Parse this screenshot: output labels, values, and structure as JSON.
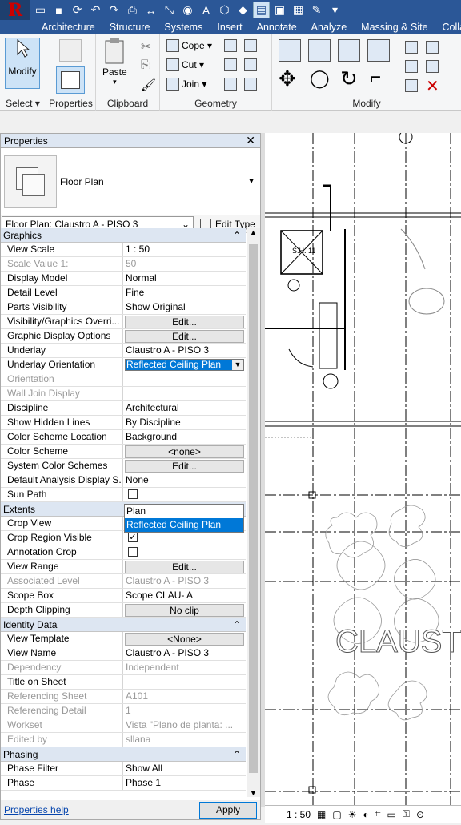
{
  "ribbon": {
    "tabs": [
      "Architecture",
      "Structure",
      "Systems",
      "Insert",
      "Annotate",
      "Analyze",
      "Massing & Site",
      "Colla"
    ],
    "panels": {
      "select": "Select",
      "properties": "Properties",
      "clipboard": "Clipboard",
      "geometry": "Geometry",
      "modify": "Modify"
    },
    "buttons": {
      "modify": "Modify",
      "paste": "Paste",
      "cope": "Cope",
      "cut": "Cut",
      "join": "Join"
    }
  },
  "properties": {
    "title": "Properties",
    "type_name": "Floor Plan",
    "instance": "Floor Plan: Claustro A - PISO 3",
    "edit_type": "Edit Type",
    "help": "Properties help",
    "apply": "Apply",
    "sections": {
      "graphics": "Graphics",
      "extents": "Extents",
      "identity": "Identity Data",
      "phasing": "Phasing"
    },
    "graphics": [
      [
        "View Scale",
        "1 : 50"
      ],
      [
        "Scale Value    1:",
        "50"
      ],
      [
        "Display Model",
        "Normal"
      ],
      [
        "Detail Level",
        "Fine"
      ],
      [
        "Parts Visibility",
        "Show Original"
      ],
      [
        "Visibility/Graphics Overri...",
        "Edit..."
      ],
      [
        "Graphic Display Options",
        "Edit..."
      ],
      [
        "Underlay",
        "Claustro A - PISO 3"
      ],
      [
        "Underlay Orientation",
        "Reflected Ceiling Plan"
      ],
      [
        "Orientation",
        ""
      ],
      [
        "Wall Join Display",
        ""
      ],
      [
        "Discipline",
        "Architectural"
      ],
      [
        "Show Hidden Lines",
        "By Discipline"
      ],
      [
        "Color Scheme Location",
        "Background"
      ],
      [
        "Color Scheme",
        "<none>"
      ],
      [
        "System Color Schemes",
        "Edit..."
      ],
      [
        "Default Analysis Display S...",
        "None"
      ],
      [
        "Sun Path",
        ""
      ]
    ],
    "extents": [
      [
        "Crop View",
        ""
      ],
      [
        "Crop Region Visible",
        ""
      ],
      [
        "Annotation Crop",
        ""
      ],
      [
        "View Range",
        "Edit..."
      ],
      [
        "Associated Level",
        "Claustro A - PISO 3"
      ],
      [
        "Scope Box",
        "Scope CLAU- A"
      ],
      [
        "Depth Clipping",
        "No clip"
      ]
    ],
    "identity": [
      [
        "View Template",
        "<None>"
      ],
      [
        "View Name",
        "Claustro A - PISO 3"
      ],
      [
        "Dependency",
        "Independent"
      ],
      [
        "Title on Sheet",
        ""
      ],
      [
        "Referencing Sheet",
        "A101"
      ],
      [
        "Referencing Detail",
        "1"
      ],
      [
        "Workset",
        "Vista \"Plano de planta: ..."
      ],
      [
        "Edited by",
        "sllana"
      ]
    ],
    "phasing": [
      [
        "Phase Filter",
        "Show All"
      ],
      [
        "Phase",
        "Phase 1"
      ]
    ],
    "dropdown": [
      "Plan",
      "Reflected Ceiling Plan"
    ]
  },
  "canvas": {
    "label": "CLAUST",
    "room": "S.H. 11",
    "scale": "1 : 50"
  }
}
